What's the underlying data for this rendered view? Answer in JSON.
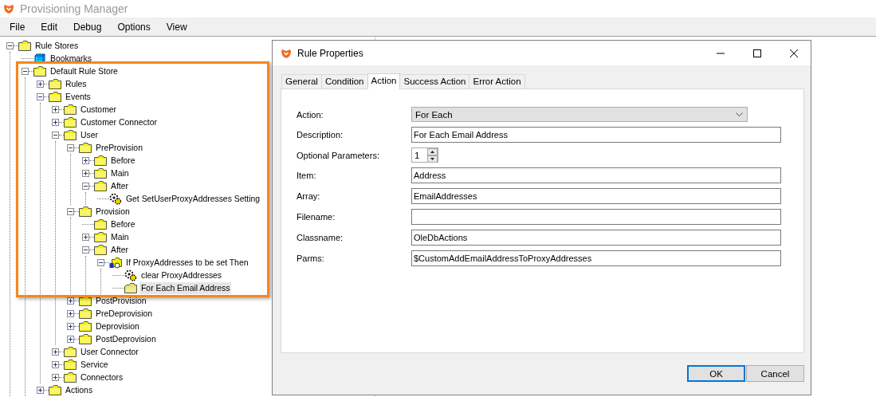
{
  "window": {
    "title": "Provisioning Manager"
  },
  "menu": [
    "File",
    "Edit",
    "Debug",
    "Options",
    "View"
  ],
  "tree": [
    {
      "label": "Rule Stores",
      "kind": "folder",
      "expanded": true,
      "selected": false,
      "children": [
        {
          "label": "Bookmarks",
          "kind": "bookmark",
          "selected": false
        },
        {
          "label": "Default Rule Store",
          "kind": "folder",
          "expanded": true,
          "selected": false,
          "children": [
            {
              "label": "Rules",
              "kind": "folder",
              "expanded": false,
              "selected": false
            },
            {
              "label": "Events",
              "kind": "folder",
              "expanded": true,
              "selected": false,
              "children": [
                {
                  "label": "Customer",
                  "kind": "folder",
                  "expanded": false,
                  "selected": false
                },
                {
                  "label": "Customer Connector",
                  "kind": "folder",
                  "expanded": false,
                  "selected": false
                },
                {
                  "label": "User",
                  "kind": "folder",
                  "expanded": true,
                  "selected": false,
                  "children": [
                    {
                      "label": "PreProvision",
                      "kind": "folder",
                      "expanded": true,
                      "selected": false,
                      "children": [
                        {
                          "label": "Before",
                          "kind": "folder",
                          "expanded": false,
                          "selected": false
                        },
                        {
                          "label": "Main",
                          "kind": "folder",
                          "expanded": false,
                          "selected": false
                        },
                        {
                          "label": "After",
                          "kind": "folder",
                          "expanded": true,
                          "selected": false,
                          "children": [
                            {
                              "label": "Get SetUserProxyAddresses Setting",
                              "kind": "gear",
                              "selected": false
                            }
                          ]
                        }
                      ]
                    },
                    {
                      "label": "Provision",
                      "kind": "folder",
                      "expanded": true,
                      "selected": false,
                      "children": [
                        {
                          "label": "Before",
                          "kind": "folder",
                          "selected": false
                        },
                        {
                          "label": "Main",
                          "kind": "folder",
                          "expanded": false,
                          "selected": false
                        },
                        {
                          "label": "After",
                          "kind": "folder",
                          "expanded": true,
                          "selected": false,
                          "children": [
                            {
                              "label": "If ProxyAddresses to be set Then",
                              "kind": "condition",
                              "expanded": true,
                              "selected": false,
                              "children": [
                                {
                                  "label": "clear ProxyAddresses",
                                  "kind": "gear",
                                  "selected": false
                                },
                                {
                                  "label": "For Each Email Address",
                                  "kind": "loop",
                                  "selected": true
                                }
                              ]
                            }
                          ]
                        }
                      ]
                    },
                    {
                      "label": "PostProvision",
                      "kind": "folder",
                      "expanded": false,
                      "selected": false
                    },
                    {
                      "label": "PreDeprovision",
                      "kind": "folder",
                      "expanded": false,
                      "selected": false
                    },
                    {
                      "label": "Deprovision",
                      "kind": "folder",
                      "expanded": false,
                      "selected": false
                    },
                    {
                      "label": "PostDeprovision",
                      "kind": "folder",
                      "expanded": false,
                      "selected": false
                    }
                  ]
                },
                {
                  "label": "User Connector",
                  "kind": "folder",
                  "expanded": false,
                  "selected": false
                },
                {
                  "label": "Service",
                  "kind": "folder",
                  "expanded": false,
                  "selected": false
                },
                {
                  "label": "Connectors",
                  "kind": "folder",
                  "expanded": false,
                  "selected": false
                }
              ]
            },
            {
              "label": "Actions",
              "kind": "folder",
              "expanded": false,
              "selected": false
            }
          ]
        }
      ]
    }
  ],
  "dialog": {
    "title": "Rule Properties",
    "tabs": [
      {
        "label": "General",
        "selected": false
      },
      {
        "label": "Condition",
        "selected": false
      },
      {
        "label": "Action",
        "selected": true
      },
      {
        "label": "Success Action",
        "selected": false
      },
      {
        "label": "Error Action",
        "selected": false
      }
    ],
    "fields": [
      {
        "kind": "dropdown",
        "label": "Action:",
        "value": "For Each"
      },
      {
        "kind": "text",
        "label": "Description:",
        "value": "For Each Email Address"
      },
      {
        "kind": "spinner",
        "label": "Optional Parameters:",
        "value": "1"
      },
      {
        "kind": "text",
        "label": "Item:",
        "value": "Address"
      },
      {
        "kind": "text",
        "label": "Array:",
        "value": "EmailAddresses"
      },
      {
        "kind": "text",
        "label": "Filename:"
      },
      {
        "kind": "text",
        "label": "Classname:",
        "value": "OleDbActions"
      },
      {
        "kind": "text",
        "label": "Parms:",
        "value": "$CustomAddEmailAddressToProxyAddresses"
      }
    ],
    "buttons": [
      {
        "label": "OK",
        "default": true
      },
      {
        "label": "Cancel",
        "default": false
      }
    ]
  }
}
